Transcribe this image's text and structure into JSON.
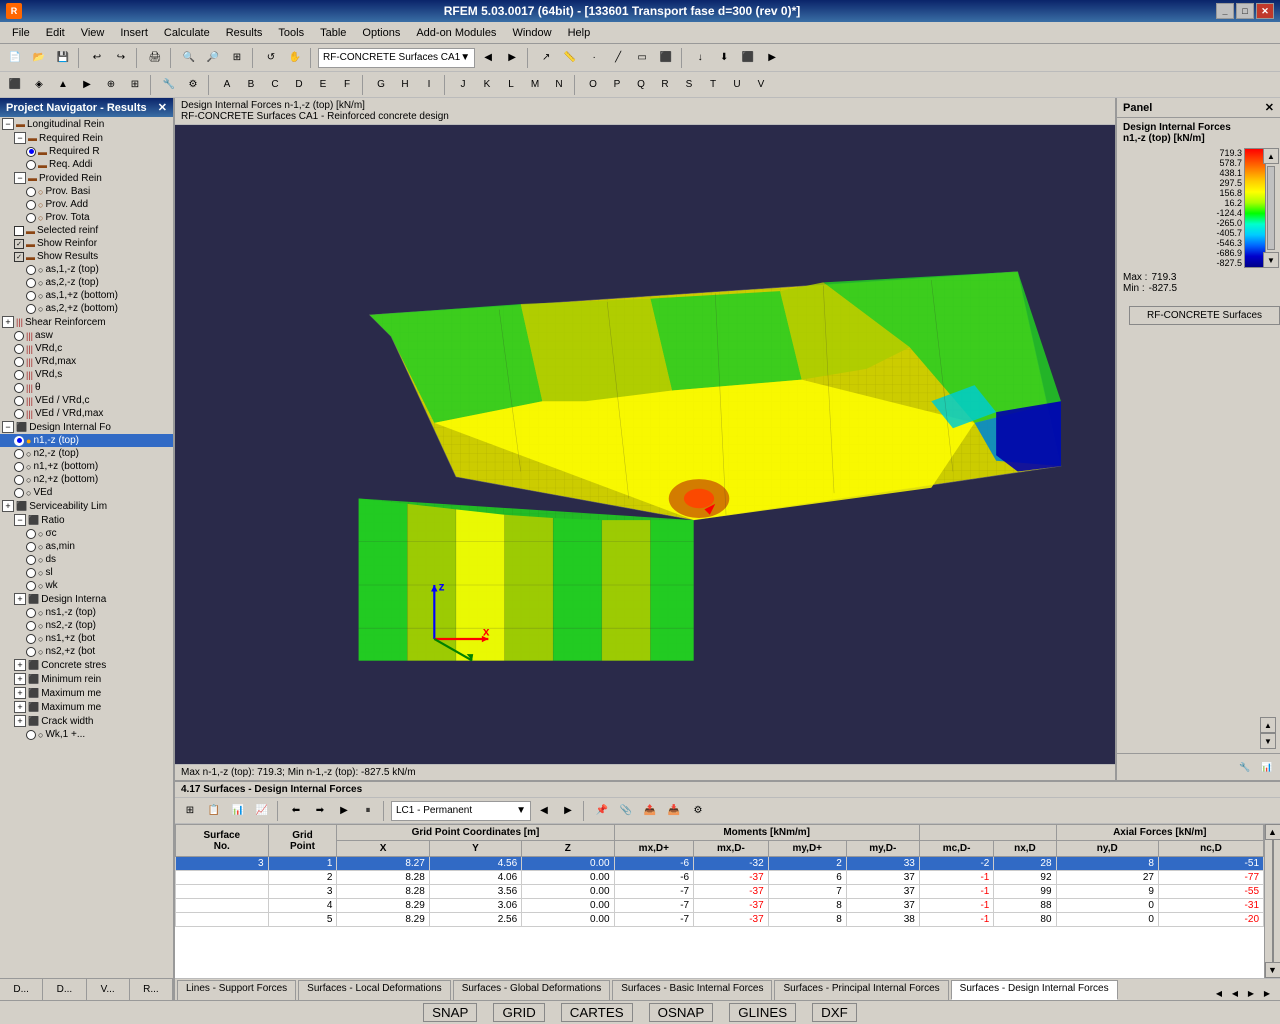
{
  "titleBar": {
    "title": "RFEM 5.03.0017 (64bit) - [133601 Transport fase d=300 (rev 0)*]",
    "icon": "R"
  },
  "menuBar": {
    "items": [
      "File",
      "Edit",
      "View",
      "Insert",
      "Calculate",
      "Results",
      "Tools",
      "Table",
      "Options",
      "Add-on Modules",
      "Window",
      "Help"
    ]
  },
  "navPanel": {
    "title": "Project Navigator - Results",
    "items": [
      {
        "label": "Longitudinal Rein",
        "indent": 0,
        "type": "expand",
        "expanded": true
      },
      {
        "label": "Required Rein",
        "indent": 1,
        "type": "expand",
        "expanded": true
      },
      {
        "label": "Required R",
        "indent": 2,
        "type": "radio-checked"
      },
      {
        "label": "Req. Addi",
        "indent": 2,
        "type": "radio"
      },
      {
        "label": "Provided Rein",
        "indent": 1,
        "type": "expand",
        "expanded": true
      },
      {
        "label": "Prov. Basi",
        "indent": 2,
        "type": "radio"
      },
      {
        "label": "Prov. Add",
        "indent": 2,
        "type": "radio"
      },
      {
        "label": "Prov. Tota",
        "indent": 2,
        "type": "radio"
      },
      {
        "label": "Selected reinf",
        "indent": 1,
        "type": "check-unchecked"
      },
      {
        "label": "Show Reinfor",
        "indent": 1,
        "type": "check-checked"
      },
      {
        "label": "Show Results",
        "indent": 1,
        "type": "check-checked"
      },
      {
        "label": "as,1,-z (top)",
        "indent": 2,
        "type": "radio"
      },
      {
        "label": "as,2,-z (top)",
        "indent": 2,
        "type": "radio"
      },
      {
        "label": "as,1,+z (bottom)",
        "indent": 2,
        "type": "radio"
      },
      {
        "label": "as,2,+z (bottom)",
        "indent": 2,
        "type": "radio"
      },
      {
        "label": "Shear Reinforcem",
        "indent": 0,
        "type": "expand"
      },
      {
        "label": "asw",
        "indent": 2,
        "type": "bars"
      },
      {
        "label": "VRd,c",
        "indent": 2,
        "type": "bars"
      },
      {
        "label": "VRd,max",
        "indent": 2,
        "type": "bars"
      },
      {
        "label": "VRd,s",
        "indent": 2,
        "type": "bars"
      },
      {
        "label": "θ",
        "indent": 2,
        "type": "bars"
      },
      {
        "label": "VEd / VRd,c",
        "indent": 2,
        "type": "bars"
      },
      {
        "label": "VEd / VRd,max",
        "indent": 2,
        "type": "bars"
      },
      {
        "label": "Design Internal Fo",
        "indent": 0,
        "type": "expand",
        "expanded": true
      },
      {
        "label": "n1,-z (top)",
        "indent": 2,
        "type": "radio-checked"
      },
      {
        "label": "n2,-z (top)",
        "indent": 2,
        "type": "radio"
      },
      {
        "label": "n1,+z (bottom)",
        "indent": 2,
        "type": "radio"
      },
      {
        "label": "n2,+z (bottom)",
        "indent": 2,
        "type": "radio"
      },
      {
        "label": "VEd",
        "indent": 2,
        "type": "radio"
      },
      {
        "label": "Serviceability Lim",
        "indent": 0,
        "type": "expand"
      },
      {
        "label": "Ratio",
        "indent": 1,
        "type": "expand",
        "expanded": true
      },
      {
        "label": "σc",
        "indent": 2,
        "type": "radio"
      },
      {
        "label": "as,min",
        "indent": 2,
        "type": "radio"
      },
      {
        "label": "ds",
        "indent": 2,
        "type": "radio"
      },
      {
        "label": "sl",
        "indent": 2,
        "type": "radio"
      },
      {
        "label": "wk",
        "indent": 2,
        "type": "radio"
      },
      {
        "label": "Design Interna",
        "indent": 1,
        "type": "expand"
      },
      {
        "label": "ns1,-z (top)",
        "indent": 2,
        "type": "radio"
      },
      {
        "label": "ns2,-z (top)",
        "indent": 2,
        "type": "radio"
      },
      {
        "label": "ns1,+z (bott",
        "indent": 2,
        "type": "radio"
      },
      {
        "label": "ns2,+z (bott",
        "indent": 2,
        "type": "radio"
      },
      {
        "label": "Concrete stres",
        "indent": 1,
        "type": "expand"
      },
      {
        "label": "Minimum rein",
        "indent": 1,
        "type": "expand"
      },
      {
        "label": "Maximum me",
        "indent": 1,
        "type": "expand"
      },
      {
        "label": "Maximum me",
        "indent": 1,
        "type": "expand"
      },
      {
        "label": "Crack width",
        "indent": 1,
        "type": "expand"
      },
      {
        "label": "Wk,1 +...",
        "indent": 2,
        "type": "radio"
      }
    ],
    "bottomTabs": [
      "D...",
      "D...",
      "V...",
      "R..."
    ]
  },
  "viewport": {
    "header1": "Design Internal Forces n-1,-z (top) [kN/m]",
    "header2": "RF-CONCRETE Surfaces CA1 - Reinforced concrete design",
    "status": "Max n-1,-z (top): 719.3; Min n-1,-z (top): -827.5 kN/m"
  },
  "legend": {
    "title": "Panel",
    "subtitle": "Design Internal Forces",
    "subtitle2": "n1,-z (top) [kN/m]",
    "values": [
      "719.3",
      "578.7",
      "438.1",
      "297.5",
      "156.8",
      "16.2",
      "-124.4",
      "-265.0",
      "-405.7",
      "-546.3",
      "-686.9",
      "-827.5"
    ],
    "max_label": "Max :",
    "max_val": "719.3",
    "min_label": "Min :",
    "min_val": "-827.5",
    "button": "RF-CONCRETE Surfaces"
  },
  "tableArea": {
    "header": "4.17 Surfaces - Design Internal Forces",
    "loadCase": "LC1 - Permanent",
    "columns": {
      "A": "Surface No.",
      "B": "Grid Point",
      "C": "X",
      "D": "Y",
      "E": "Z",
      "F_header": "Grid Point Coordinates [m]",
      "G": "mx,D+",
      "H": "mx,D-",
      "I": "my,D+",
      "J": "my,D-",
      "K": "mc,D-",
      "L1": "nx,D",
      "L2": "ny,D",
      "M": "nc,D",
      "moments_header": "Moments [kNm/m]",
      "axial_header": "Axial Forces [kN/m]"
    },
    "rows": [
      {
        "no": "3",
        "point": "1",
        "x": "8.27",
        "y": "4.56",
        "z": "0.00",
        "mxDp": "-6",
        "mxDm": "-32",
        "myDp": "2",
        "myDm": "33",
        "mcDm": "-2",
        "nxD": "28",
        "nyD": "8",
        "ncD": "-51"
      },
      {
        "no": "",
        "point": "2",
        "x": "8.28",
        "y": "4.06",
        "z": "0.00",
        "mxDp": "-6",
        "mxDm": "-37",
        "myDp": "6",
        "myDm": "37",
        "mcDm": "-1",
        "nxD": "92",
        "nyD": "27",
        "ncD": "-77"
      },
      {
        "no": "",
        "point": "3",
        "x": "8.28",
        "y": "3.56",
        "z": "0.00",
        "mxDp": "-7",
        "mxDm": "-37",
        "myDp": "7",
        "myDm": "37",
        "mcDm": "-1",
        "nxD": "99",
        "nyD": "9",
        "ncD": "-55"
      },
      {
        "no": "",
        "point": "4",
        "x": "8.29",
        "y": "3.06",
        "z": "0.00",
        "mxDp": "-7",
        "mxDm": "-37",
        "myDp": "8",
        "myDm": "37",
        "mcDm": "-1",
        "nxD": "88",
        "nyD": "0",
        "ncD": "-31"
      },
      {
        "no": "",
        "point": "5",
        "x": "8.29",
        "y": "2.56",
        "z": "0.00",
        "mxDp": "-7",
        "mxDm": "-37",
        "myDp": "8",
        "myDm": "38",
        "mcDm": "-1",
        "nxD": "80",
        "nyD": "0",
        "ncD": "-20"
      }
    ]
  },
  "tabs": [
    {
      "label": "Lines - Support Forces",
      "active": false
    },
    {
      "label": "Surfaces - Local Deformations",
      "active": false
    },
    {
      "label": "Surfaces - Global Deformations",
      "active": false
    },
    {
      "label": "Surfaces - Basic Internal Forces",
      "active": false
    },
    {
      "label": "Surfaces - Principal Internal Forces",
      "active": false
    },
    {
      "label": "Surfaces - Design Internal Forces",
      "active": true
    }
  ],
  "statusBar": {
    "items": [
      "SNAP",
      "GRID",
      "CARTES",
      "OSNAP",
      "GLINES",
      "DXF"
    ]
  }
}
